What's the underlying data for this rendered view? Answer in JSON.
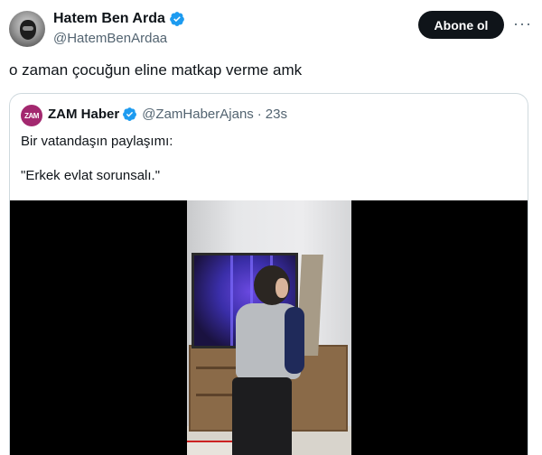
{
  "author": {
    "display_name": "Hatem Ben Arda",
    "handle": "@HatemBenArdaa",
    "verified": true,
    "avatar_icon": "masked-person-avatar"
  },
  "follow_button": {
    "label": "Abone ol"
  },
  "more_menu": {
    "icon": "ellipsis-icon",
    "label": "···"
  },
  "tweet": {
    "text": "o zaman çocuğun eline matkap verme amk"
  },
  "quoted": {
    "avatar_text": "ZAM",
    "display_name": "ZAM Haber",
    "verified": true,
    "handle": "@ZamHaberAjans",
    "separator": "·",
    "timestamp": "23s",
    "line1": "Bir vatandaşın paylaşımı:",
    "line2": "\"Erkek evlat sorunsalı.\""
  },
  "colors": {
    "text_primary": "#0f1419",
    "text_secondary": "#536471",
    "verified_blue": "#1d9bf0",
    "button_bg": "#0f1419",
    "border": "#cfd9de",
    "zam_brand": "#a3286f"
  }
}
